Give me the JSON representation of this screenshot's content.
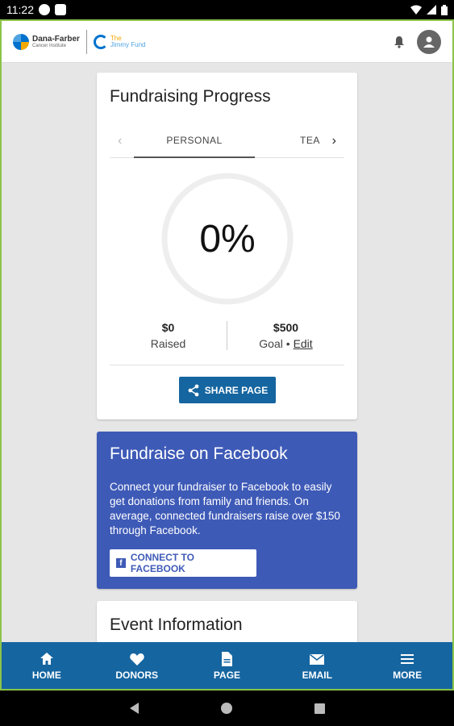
{
  "status_bar": {
    "time": "11:22",
    "icons": [
      "app-notification-icon",
      "sd-card-icon",
      "wifi-icon",
      "signal-icon",
      "battery-icon"
    ]
  },
  "header": {
    "logo_dfci": {
      "line1": "Dana-Farber",
      "line2": "Cancer Institute"
    },
    "logo_jimmy_fund": {
      "line1": "The",
      "line2": "Jimmy Fund"
    },
    "icons": [
      "bell-icon",
      "account-icon"
    ]
  },
  "progress_card": {
    "title": "Fundraising Progress",
    "tabs": [
      {
        "label": "PERSONAL",
        "active": true
      },
      {
        "label": "TEA",
        "active": false
      }
    ],
    "percent": "0%",
    "progress_value": 0,
    "raised": {
      "value": "$0",
      "label": "Raised"
    },
    "goal": {
      "value": "$500",
      "label": "Goal •",
      "edit": "Edit"
    },
    "share_button": "SHARE PAGE"
  },
  "facebook_card": {
    "title": "Fundraise on Facebook",
    "text": "Connect your fundraiser to Facebook to easily get donations from family and friends. On average, connected fundraisers raise over $150 through Facebook.",
    "button": "CONNECT TO FACEBOOK"
  },
  "event_card": {
    "title": "Event Information"
  },
  "bottom_nav": {
    "items": [
      {
        "label": "HOME",
        "icon": "home-icon"
      },
      {
        "label": "DONORS",
        "icon": "heart-icon"
      },
      {
        "label": "PAGE",
        "icon": "document-icon"
      },
      {
        "label": "EMAIL",
        "icon": "email-icon"
      },
      {
        "label": "MORE",
        "icon": "menu-icon"
      }
    ]
  },
  "colors": {
    "primary": "#1565a0",
    "facebook": "#3e5ab7",
    "frame_border": "#8bc34a",
    "background": "#e6e6e6"
  }
}
